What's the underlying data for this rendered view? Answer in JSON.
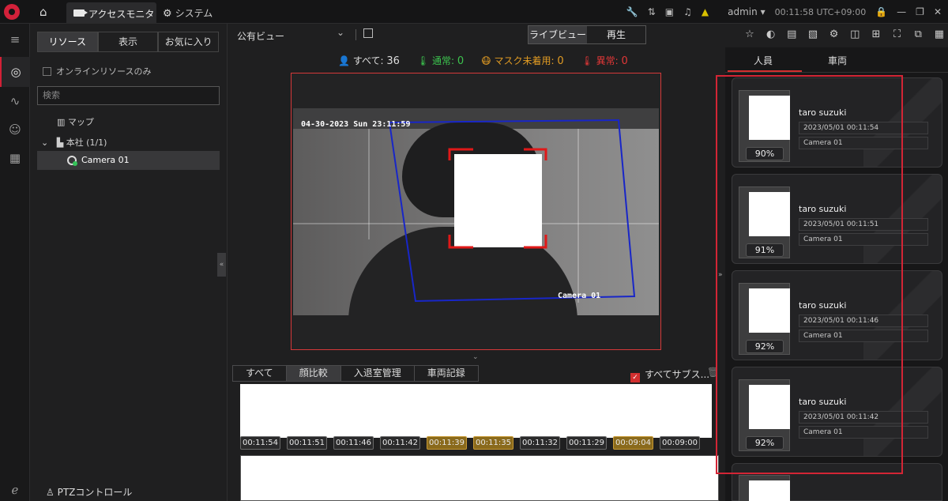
{
  "topbar": {
    "tab_monitor": "アクセスモニタ",
    "tab_system": "システム",
    "user": "admin",
    "clock": "00:11:58 UTC+09:00"
  },
  "resources": {
    "tabs": [
      "リソース",
      "表示",
      "お気に入り"
    ],
    "online_only": "オンラインリソースのみ",
    "search_placeholder": "検索",
    "tree": {
      "map": "マップ",
      "hq": "本社 (1/1)",
      "camera": "Camera 01"
    },
    "ptz": "PTZコントロール"
  },
  "toolbar": {
    "view": "公有ビュー",
    "live": "ライブビュー",
    "playback": "再生"
  },
  "stats": {
    "all_label": "すべて:",
    "all_value": "36",
    "normal_label": "通常:",
    "normal_value": "0",
    "nomask_label": "マスク未着用:",
    "nomask_value": "0",
    "abnormal_label": "異常:",
    "abnormal_value": "0"
  },
  "video": {
    "timestamp": "04-30-2023 Sun 23:11:59",
    "camera_label": "Camera 01"
  },
  "events": {
    "tabs": [
      "すべて",
      "顔比較",
      "入退室管理",
      "車両記録"
    ],
    "subscribe_all": "すべてサブス...",
    "times": [
      {
        "t": "00:11:54",
        "gold": false
      },
      {
        "t": "00:11:51",
        "gold": false
      },
      {
        "t": "00:11:46",
        "gold": false
      },
      {
        "t": "00:11:42",
        "gold": false
      },
      {
        "t": "00:11:39",
        "gold": true
      },
      {
        "t": "00:11:35",
        "gold": true
      },
      {
        "t": "00:11:32",
        "gold": false
      },
      {
        "t": "00:11:29",
        "gold": false
      },
      {
        "t": "00:09:04",
        "gold": true
      },
      {
        "t": "00:09:00",
        "gold": false
      }
    ]
  },
  "right": {
    "tab_person": "人員",
    "tab_vehicle": "車両",
    "cards": [
      {
        "name": "taro suzuki",
        "time": "2023/05/01 00:11:54",
        "camera": "Camera 01",
        "score": "90%"
      },
      {
        "name": "taro suzuki",
        "time": "2023/05/01 00:11:51",
        "camera": "Camera 01",
        "score": "91%"
      },
      {
        "name": "taro suzuki",
        "time": "2023/05/01 00:11:46",
        "camera": "Camera 01",
        "score": "92%"
      },
      {
        "name": "taro suzuki",
        "time": "2023/05/01 00:11:42",
        "camera": "Camera 01",
        "score": "92%"
      }
    ]
  },
  "colors": {
    "accent": "#d32036",
    "normal": "#3cc34e",
    "nomask": "#e19b23",
    "abnormal": "#e23737"
  }
}
